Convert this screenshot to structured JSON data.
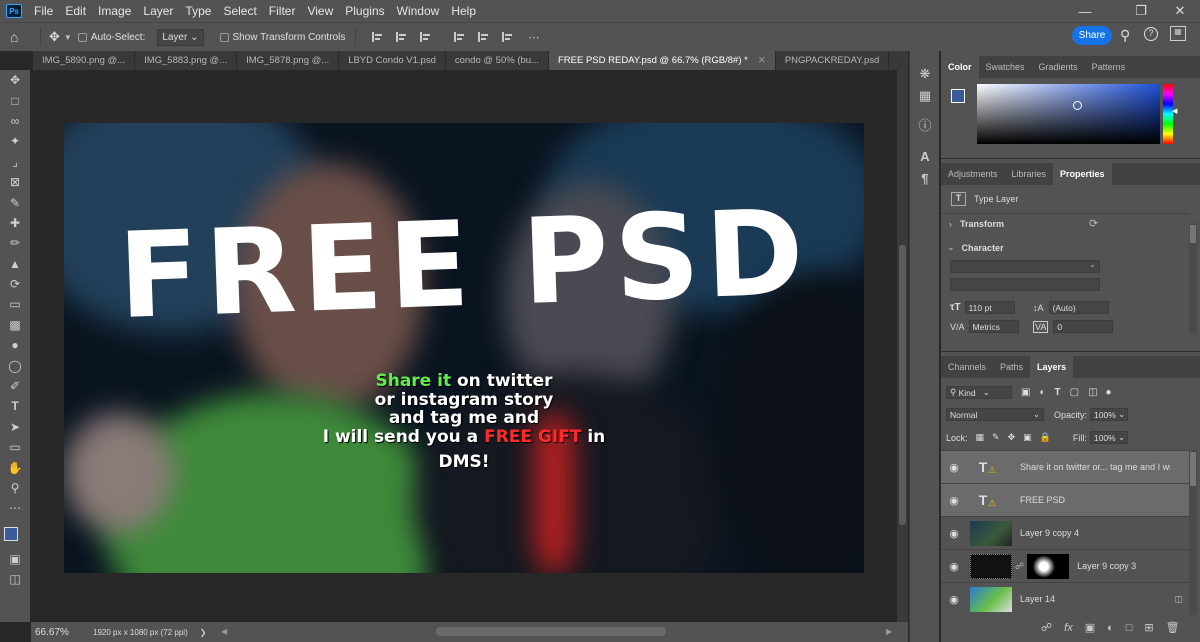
{
  "menubar": {
    "items": [
      "File",
      "Edit",
      "Image",
      "Layer",
      "Type",
      "Select",
      "Filter",
      "View",
      "Plugins",
      "Window",
      "Help"
    ]
  },
  "optionsbar": {
    "auto_select_label": "Auto-Select:",
    "auto_select_value": "Layer",
    "show_transform_label": "Show Transform Controls",
    "share_label": "Share"
  },
  "tabs": [
    {
      "label": "IMG_5890.png @...",
      "active": false
    },
    {
      "label": "IMG_5883.png @...",
      "active": false
    },
    {
      "label": "IMG_5878.png @...",
      "active": false
    },
    {
      "label": "LBYD Condo V1.psd",
      "active": false
    },
    {
      "label": "condo @ 50% (bu...",
      "active": false
    },
    {
      "label": "FREE PSD REDAY.psd @ 66.7% (RGB/8#) *",
      "active": true
    },
    {
      "label": "PNGPACKREDAY.psd",
      "active": false
    }
  ],
  "document": {
    "headline": "FREE PSD",
    "line1_a": "Share it",
    "line1_b": "on twitter",
    "line2": "or instagram story",
    "line3": "and tag me and",
    "line4_a": "I will send you a",
    "line4_b": "FREE GIFT",
    "line4_c": "in",
    "line5": "DMS!",
    "green": "#5ef04a",
    "red": "#ff2a2a"
  },
  "status": {
    "zoom": "66.67%",
    "info": "1920 px x 1080 px (72 ppi)"
  },
  "color_panel": {
    "tabs": [
      "Color",
      "Swatches",
      "Gradients",
      "Patterns"
    ],
    "fg": "#3a5a9c"
  },
  "properties_panel": {
    "tabs": [
      "Adjustments",
      "Libraries",
      "Properties"
    ],
    "type_layer_label": "Type Layer",
    "transform_label": "Transform",
    "character_label": "Character",
    "font_size": "110 pt",
    "leading": "(Auto)",
    "kerning": "Metrics",
    "tracking": "0"
  },
  "layers_panel": {
    "tabs": [
      "Channels",
      "Paths",
      "Layers"
    ],
    "filter_kind": "Kind",
    "blend_mode": "Normal",
    "opacity_label": "Opacity:",
    "opacity": "100%",
    "lock_label": "Lock:",
    "fill_label": "Fill:",
    "fill": "100%",
    "layers": [
      {
        "name": "Share it on twitter or... tag me and  I will s",
        "type": "text",
        "selected": true
      },
      {
        "name": "FREE PSD",
        "type": "text",
        "selected": true
      },
      {
        "name": "Layer 9 copy 4",
        "type": "image",
        "selected": false
      },
      {
        "name": "Layer 9 copy 3",
        "type": "masked",
        "selected": false
      },
      {
        "name": "Layer 14",
        "type": "image",
        "selected": false
      }
    ]
  }
}
